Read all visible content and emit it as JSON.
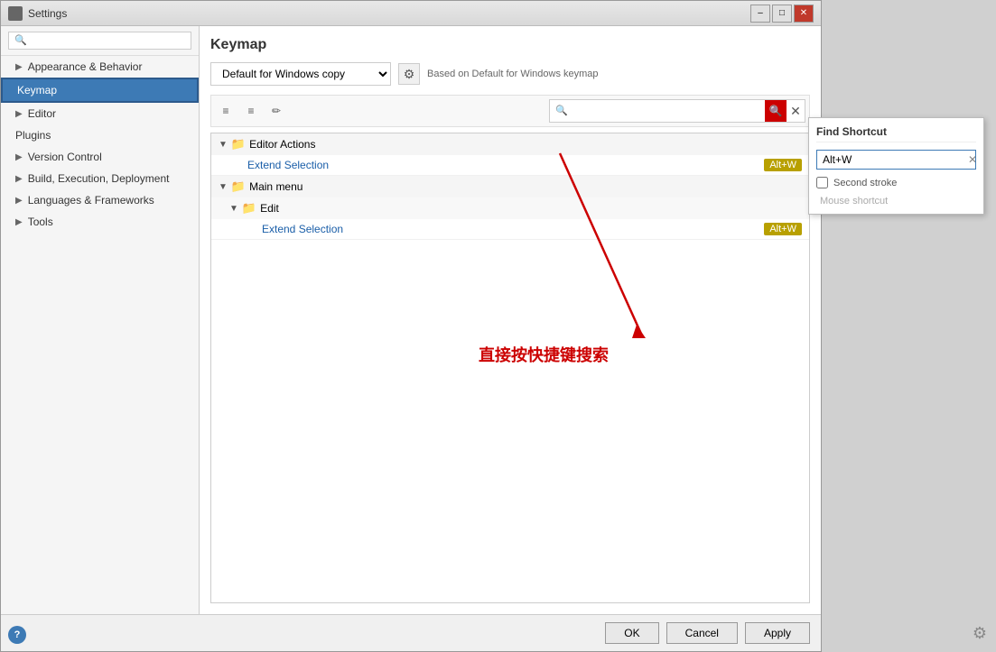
{
  "window": {
    "title": "Settings",
    "title_icon": "⚙"
  },
  "titlebar": {
    "minimize_label": "–",
    "maximize_label": "□",
    "close_label": "✕"
  },
  "sidebar": {
    "search_placeholder": "🔍",
    "items": [
      {
        "id": "appearance-behavior",
        "label": "Appearance & Behavior",
        "has_arrow": true
      },
      {
        "id": "keymap",
        "label": "Keymap",
        "active": true
      },
      {
        "id": "editor",
        "label": "Editor",
        "has_arrow": true
      },
      {
        "id": "plugins",
        "label": "Plugins"
      },
      {
        "id": "version-control",
        "label": "Version Control",
        "has_arrow": true
      },
      {
        "id": "build-execution-deployment",
        "label": "Build, Execution, Deployment",
        "has_arrow": true
      },
      {
        "id": "languages-frameworks",
        "label": "Languages & Frameworks",
        "has_arrow": true
      },
      {
        "id": "tools",
        "label": "Tools",
        "has_arrow": true
      }
    ]
  },
  "main": {
    "title": "Keymap",
    "keymap_select_value": "Default for Windows copy",
    "based_on_text": "Based on Default for Windows keymap",
    "toolbar": {
      "align_left_label": "≡",
      "align_right_label": "≡",
      "edit_label": "✏"
    },
    "search_placeholder": "🔍",
    "tree": {
      "groups": [
        {
          "label": "Editor Actions",
          "items": [
            {
              "label": "Extend Selection",
              "shortcut": "Alt+W"
            }
          ]
        },
        {
          "label": "Main menu",
          "subgroups": [
            {
              "label": "Edit",
              "items": [
                {
                  "label": "Extend Selection",
                  "shortcut": "Alt+W"
                }
              ]
            }
          ]
        }
      ]
    }
  },
  "find_shortcut": {
    "title": "Find Shortcut",
    "input_value": "Alt+W",
    "second_stroke_label": "Second stroke",
    "mouse_shortcut_label": "Mouse shortcut",
    "clear_btn_label": "✕"
  },
  "footer": {
    "ok_label": "OK",
    "cancel_label": "Cancel",
    "apply_label": "Apply"
  },
  "annotation": {
    "text": "直接按快捷键搜索"
  }
}
